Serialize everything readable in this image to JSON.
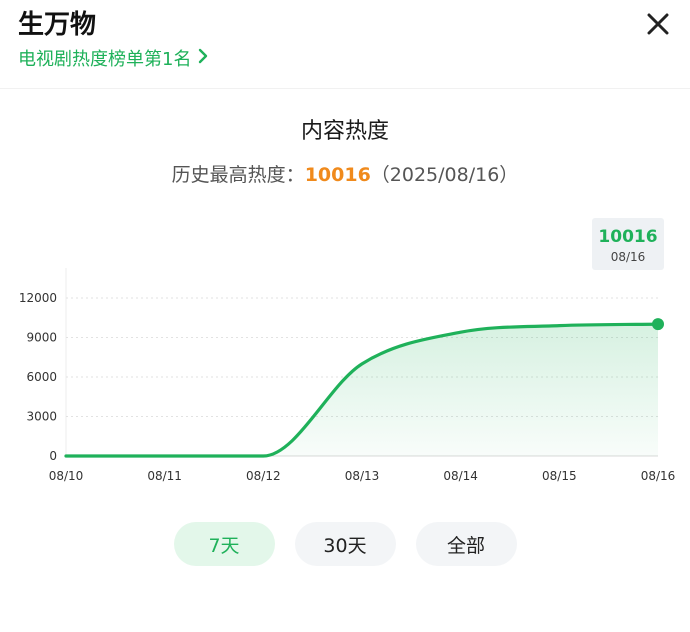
{
  "header": {
    "title": "生万物",
    "ranking_link": "电视剧热度榜单第1名",
    "icons": {
      "ranking_link": "chevron-right-icon",
      "close": "close-icon"
    }
  },
  "heat_panel": {
    "title": "内容热度",
    "peak_label": "历史最高热度：",
    "peak_value": "10016",
    "peak_date": "（2025/08/16）"
  },
  "tooltip": {
    "value": "10016",
    "date": "08/16"
  },
  "tabs": [
    {
      "label": "7天",
      "active": true
    },
    {
      "label": "30天",
      "active": false
    },
    {
      "label": "全部",
      "active": false
    }
  ],
  "colors": {
    "accent": "#1fb15a",
    "peak": "#f08a1c",
    "active_tab_bg": "#e3f7ea",
    "tab_bg": "#f3f5f7"
  },
  "chart_data": {
    "type": "area",
    "x": [
      "08/10",
      "08/11",
      "08/12",
      "08/13",
      "08/14",
      "08/15",
      "08/16"
    ],
    "series": [
      {
        "values": [
          0,
          0,
          0,
          7000,
          9400,
          9900,
          10016
        ]
      }
    ],
    "y_ticks": [
      "0",
      "3000",
      "6000",
      "9000",
      "12000"
    ],
    "ylim": [
      0,
      12000
    ],
    "grid": true
  }
}
